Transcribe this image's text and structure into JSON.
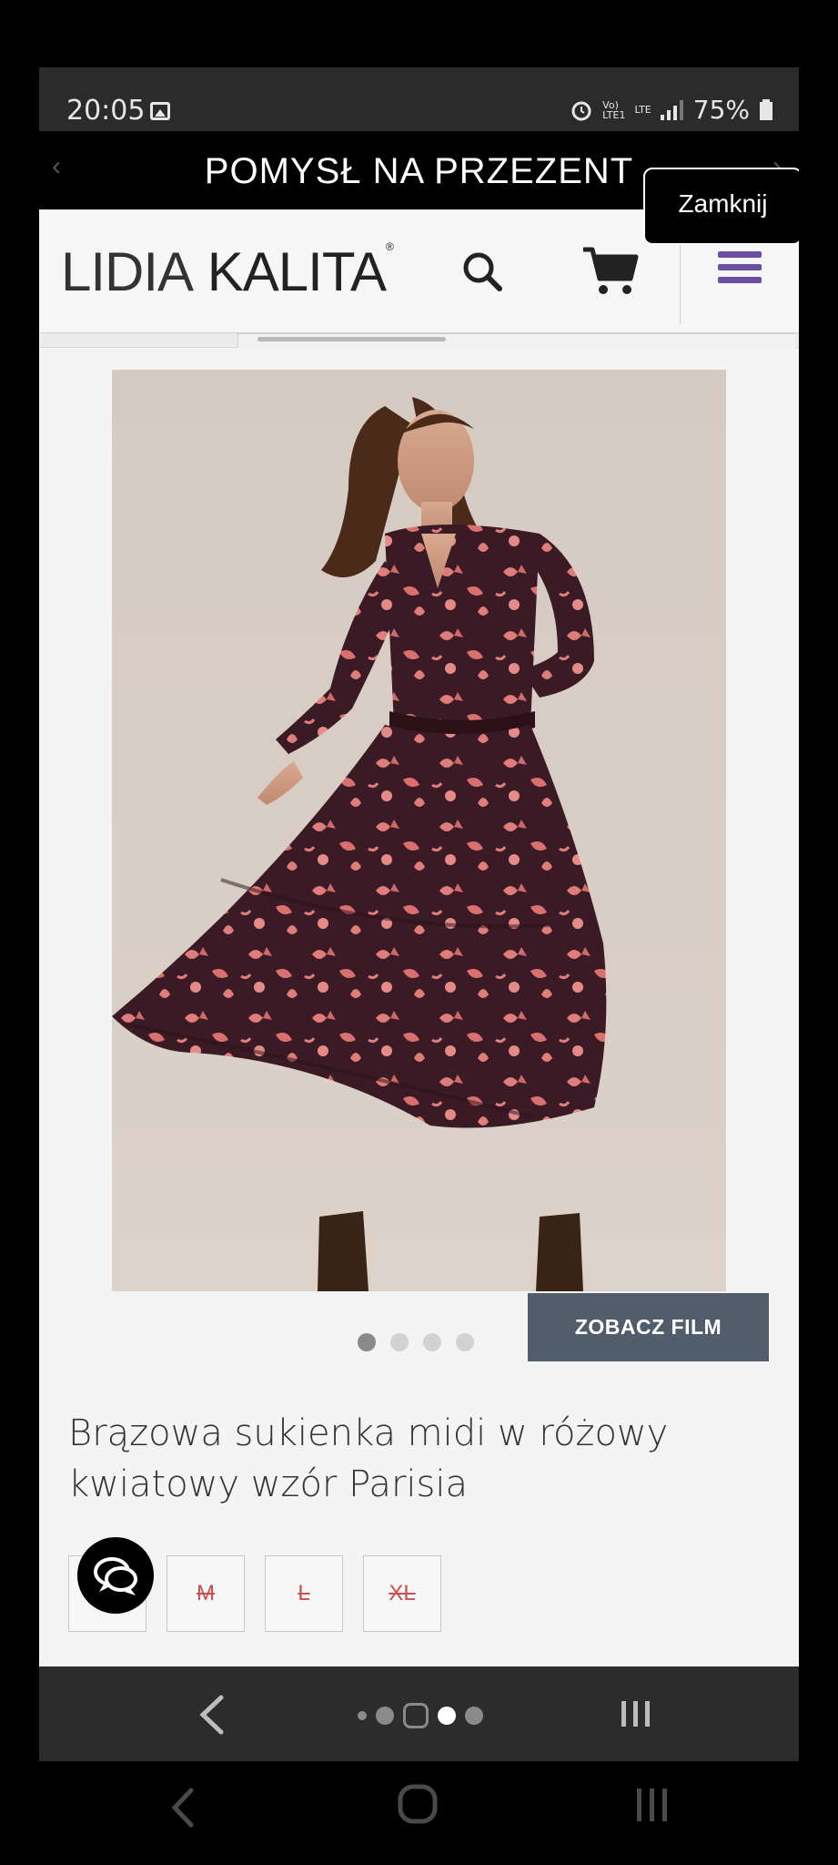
{
  "status_bar": {
    "time": "20:05",
    "network_top": "Vo)",
    "network_bottom": "LTE1",
    "lte": "LTE",
    "battery": "75%"
  },
  "promo": {
    "title": "POMYSŁ NA PRZEZENT",
    "close_label": "Zamknij",
    "prev_arrow": "‹",
    "next_arrow": "›"
  },
  "header": {
    "logo_part1": "LIDIA",
    "logo_part2": "KALITA",
    "logo_mark": "®"
  },
  "gallery": {
    "slide_count": 4,
    "active_slide": 1,
    "film_button": "ZOBACZ FILM"
  },
  "product": {
    "title": "Brązowa sukienka midi w różowy kwiatowy wzór Parisia",
    "sizes": [
      "M",
      "L",
      "XL"
    ],
    "sizes_available": [
      false,
      false,
      false
    ]
  },
  "colors": {
    "menu_accent": "#6b4fa3",
    "film_button_bg": "#525d6c",
    "size_unavailable_text": "#c94f4f",
    "dress_base": "#3a1a24",
    "dress_print": "#e07c7a"
  },
  "icons": {
    "search": "search-icon",
    "cart": "cart-icon",
    "menu": "hamburger-menu-icon",
    "chat": "chat-icon"
  }
}
